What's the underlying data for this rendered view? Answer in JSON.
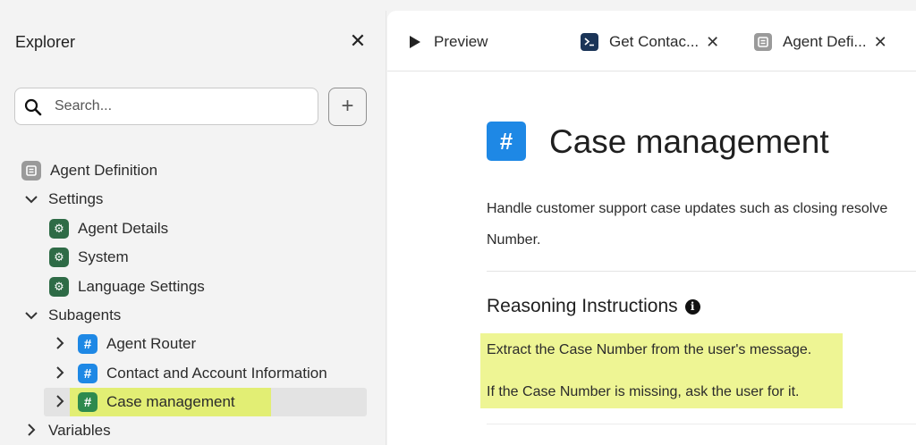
{
  "sidebar": {
    "title": "Explorer",
    "close_icon": "close-icon",
    "search": {
      "placeholder": "Search..."
    },
    "add_icon": "plus-icon",
    "tree": {
      "agent_definition": "Agent Definition",
      "settings": "Settings",
      "agent_details": "Agent Details",
      "system": "System",
      "language_settings": "Language Settings",
      "subagents": "Subagents",
      "agent_router": "Agent Router",
      "contact_account": "Contact and Account Information",
      "case_management": "Case management",
      "variables": "Variables"
    }
  },
  "tabs": [
    {
      "label": "Preview",
      "icon": "play-icon"
    },
    {
      "label": "Get Contac...",
      "icon": "terminal-icon"
    },
    {
      "label": "Agent Defi...",
      "icon": "document-icon"
    }
  ],
  "content": {
    "title": "Case management",
    "description_line1": "Handle customer support case updates such as closing resolve",
    "description_line2": "Number.",
    "section_title": "Reasoning Instructions",
    "instructions": [
      "Extract the Case Number from the user's message.",
      "If the Case Number is missing, ask the user for it."
    ]
  },
  "colors": {
    "accent_blue": "#1e88e5",
    "gear_green": "#2e6b46",
    "highlight_yellow": "#e2ee74",
    "instruction_highlight": "#eef594",
    "terminal_navy": "#1b3558"
  }
}
